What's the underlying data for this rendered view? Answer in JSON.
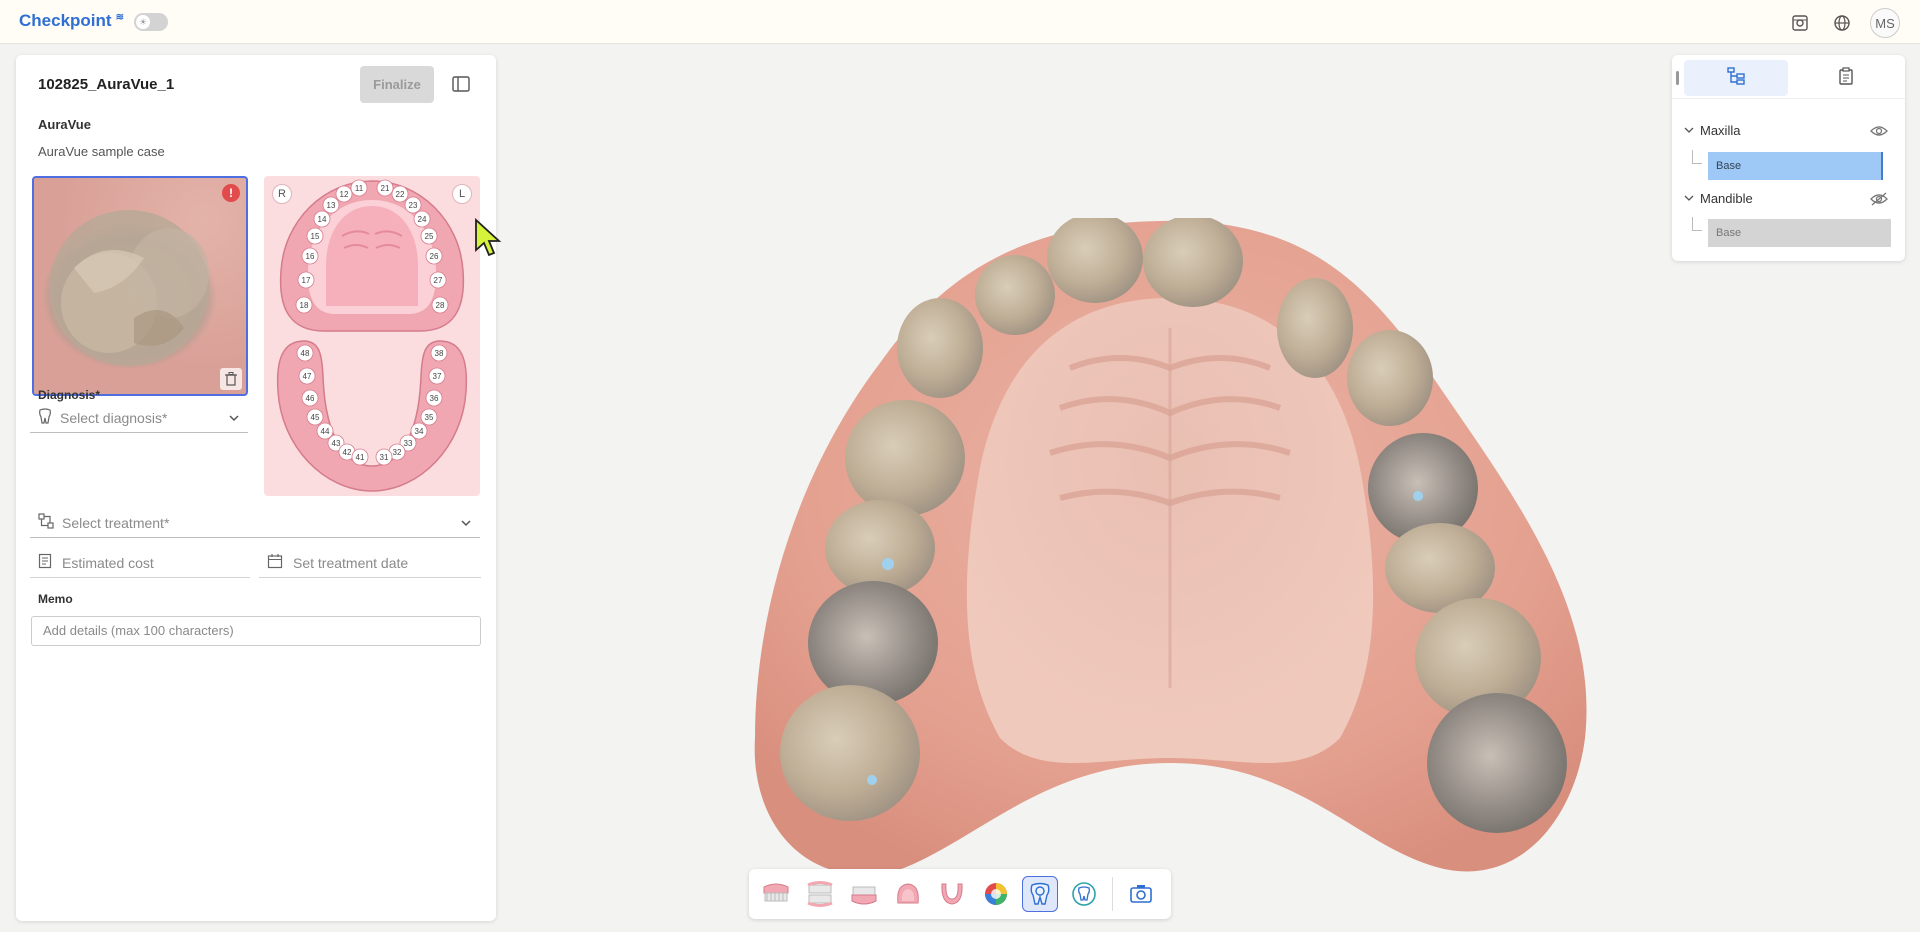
{
  "app": {
    "title": "Checkpoint",
    "avatar_initials": "MS"
  },
  "case": {
    "id": "102825_AuraVue_1",
    "finalize_label": "Finalize",
    "name": "AuraVue",
    "description": "AuraVue sample case"
  },
  "tooth_chart": {
    "right_label": "R",
    "left_label": "L",
    "upper_teeth": [
      "11",
      "21",
      "12",
      "22",
      "13",
      "23",
      "14",
      "24",
      "15",
      "25",
      "16",
      "26",
      "17",
      "27",
      "18",
      "28"
    ],
    "lower_teeth": [
      "48",
      "38",
      "47",
      "37",
      "46",
      "36",
      "45",
      "35",
      "44",
      "34",
      "43",
      "33",
      "42",
      "32",
      "41",
      "31"
    ]
  },
  "form": {
    "diagnosis_label": "Diagnosis*",
    "diagnosis_placeholder": "Select diagnosis*",
    "treatment_placeholder": "Select treatment*",
    "cost_placeholder": "Estimated cost",
    "date_placeholder": "Set treatment date",
    "memo_label": "Memo",
    "memo_placeholder": "Add details (max 100 characters)"
  },
  "model_tree": {
    "maxilla": {
      "label": "Maxilla",
      "child": "Base",
      "visible": true
    },
    "mandible": {
      "label": "Mandible",
      "child": "Base",
      "visible": false
    }
  },
  "colors": {
    "accent": "#2f6fd1",
    "selection": "#9ec8f6",
    "chart_bg": "#fbdde0"
  },
  "toolbar_icons": [
    "upper-jaw-icon",
    "occlusion-icon",
    "lower-jaw-icon",
    "palate-icon",
    "arch-icon",
    "color-wheel-icon",
    "tooth-search-icon",
    "tooth-check-icon",
    "camera-icon"
  ]
}
